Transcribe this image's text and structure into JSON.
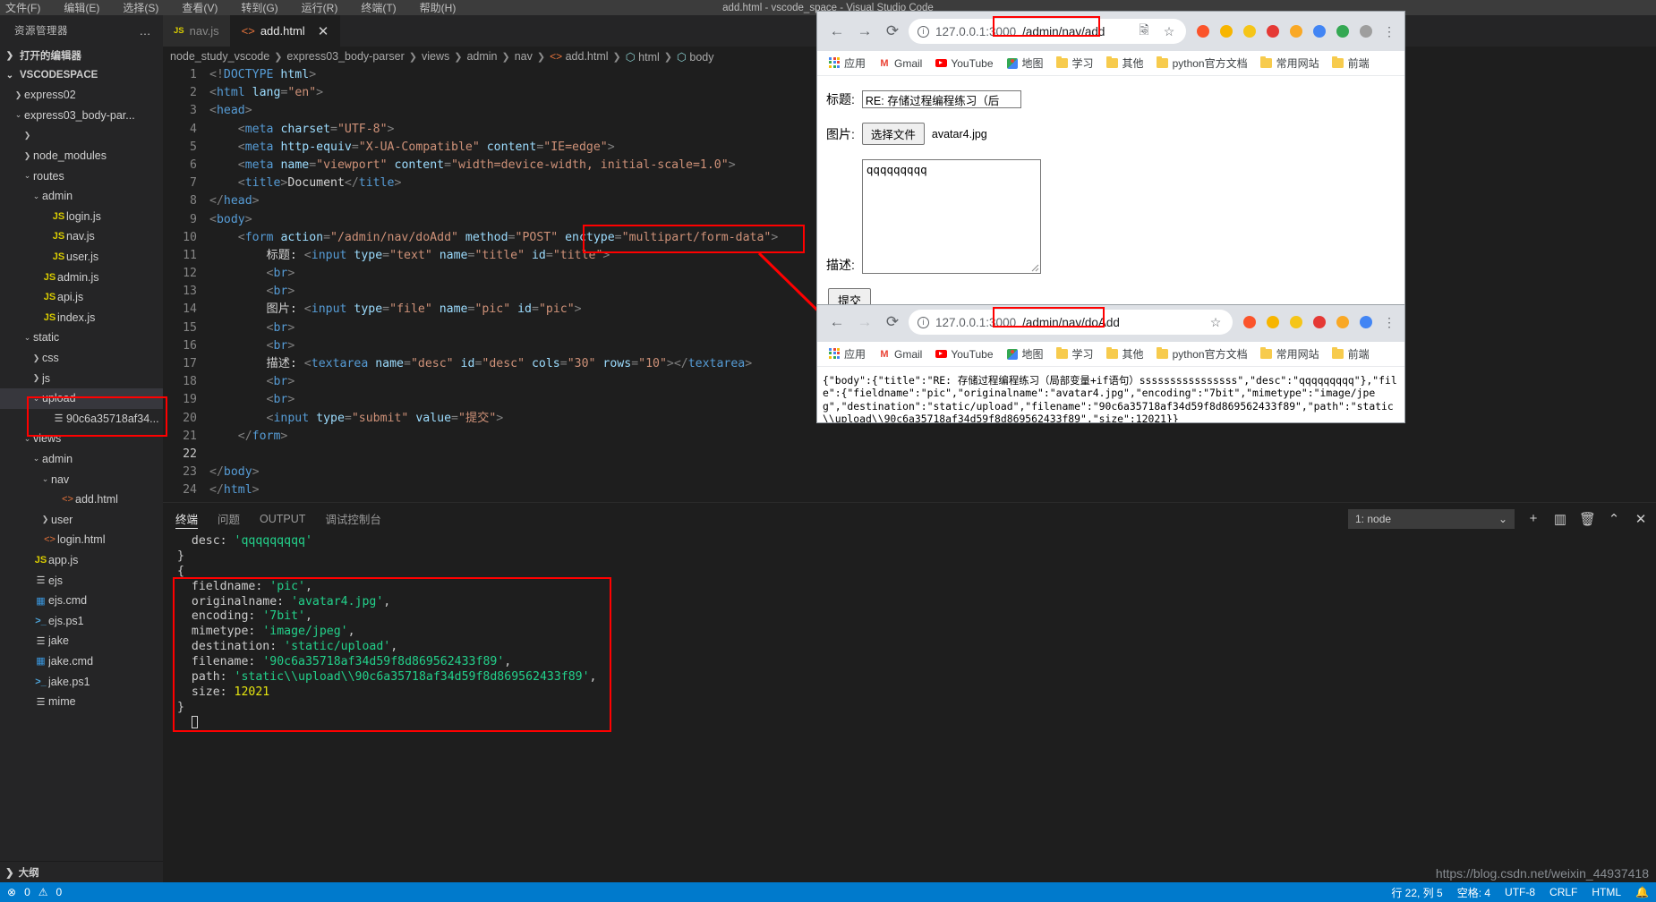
{
  "vscode": {
    "menu": [
      "文件(F)",
      "编辑(E)",
      "选择(S)",
      "查看(V)",
      "转到(G)",
      "运行(R)",
      "终端(T)",
      "帮助(H)"
    ],
    "window_title": "add.html - vscode_space - Visual Studio Code",
    "explorer": {
      "title": "资源管理器",
      "more_label": "…",
      "open_editors": "打开的编辑器",
      "workspace": "VSCODESPACE",
      "outline": "大纲",
      "tree": [
        {
          "label": "express02",
          "indent": 1,
          "chev": "collapsed",
          "icon": "none",
          "selected": false
        },
        {
          "label": "express03_body-par...",
          "indent": 1,
          "chev": "expanded",
          "icon": "none",
          "selected": false
        },
        {
          "label": "",
          "indent": 2,
          "chev": "collapsed",
          "icon": "none",
          "selected": false
        },
        {
          "label": "node_modules",
          "indent": 2,
          "chev": "collapsed",
          "icon": "none",
          "selected": false
        },
        {
          "label": "routes",
          "indent": 2,
          "chev": "expanded",
          "icon": "none",
          "selected": false
        },
        {
          "label": "admin",
          "indent": 3,
          "chev": "expanded",
          "icon": "none",
          "selected": false
        },
        {
          "label": "login.js",
          "indent": 4,
          "chev": "none",
          "icon": "js",
          "selected": false
        },
        {
          "label": "nav.js",
          "indent": 4,
          "chev": "none",
          "icon": "js",
          "selected": false
        },
        {
          "label": "user.js",
          "indent": 4,
          "chev": "none",
          "icon": "js",
          "selected": false
        },
        {
          "label": "admin.js",
          "indent": 3,
          "chev": "none",
          "icon": "js",
          "selected": false
        },
        {
          "label": "api.js",
          "indent": 3,
          "chev": "none",
          "icon": "js",
          "selected": false
        },
        {
          "label": "index.js",
          "indent": 3,
          "chev": "none",
          "icon": "js",
          "selected": false
        },
        {
          "label": "static",
          "indent": 2,
          "chev": "expanded",
          "icon": "none",
          "selected": false
        },
        {
          "label": "css",
          "indent": 3,
          "chev": "collapsed",
          "icon": "none",
          "selected": false
        },
        {
          "label": "js",
          "indent": 3,
          "chev": "collapsed",
          "icon": "none",
          "selected": false
        },
        {
          "label": "upload",
          "indent": 3,
          "chev": "expanded",
          "icon": "none",
          "selected": true
        },
        {
          "label": "90c6a35718af34...",
          "indent": 4,
          "chev": "none",
          "icon": "lines",
          "selected": false
        },
        {
          "label": "views",
          "indent": 2,
          "chev": "expanded",
          "icon": "none",
          "selected": false
        },
        {
          "label": "admin",
          "indent": 3,
          "chev": "expanded",
          "icon": "none",
          "selected": false
        },
        {
          "label": "nav",
          "indent": 4,
          "chev": "expanded",
          "icon": "none",
          "selected": false
        },
        {
          "label": "add.html",
          "indent": 5,
          "chev": "none",
          "icon": "html",
          "selected": false
        },
        {
          "label": "user",
          "indent": 4,
          "chev": "collapsed",
          "icon": "none",
          "selected": false
        },
        {
          "label": "login.html",
          "indent": 3,
          "chev": "none",
          "icon": "html",
          "selected": false
        },
        {
          "label": "app.js",
          "indent": 2,
          "chev": "none",
          "icon": "js",
          "selected": false
        },
        {
          "label": "ejs",
          "indent": 2,
          "chev": "none",
          "icon": "lines",
          "selected": false
        },
        {
          "label": "ejs.cmd",
          "indent": 2,
          "chev": "none",
          "icon": "win",
          "selected": false
        },
        {
          "label": "ejs.ps1",
          "indent": 2,
          "chev": "none",
          "icon": "ps",
          "selected": false
        },
        {
          "label": "jake",
          "indent": 2,
          "chev": "none",
          "icon": "lines",
          "selected": false
        },
        {
          "label": "jake.cmd",
          "indent": 2,
          "chev": "none",
          "icon": "win",
          "selected": false
        },
        {
          "label": "jake.ps1",
          "indent": 2,
          "chev": "none",
          "icon": "ps",
          "selected": false
        },
        {
          "label": "mime",
          "indent": 2,
          "chev": "none",
          "icon": "lines",
          "selected": false
        }
      ]
    },
    "tabs": [
      {
        "label": "nav.js",
        "icon": "js",
        "active": false,
        "closable": false
      },
      {
        "label": "add.html",
        "icon": "html",
        "active": true,
        "closable": true
      }
    ],
    "breadcrumb": [
      "node_study_vscode",
      "express03_body-parser",
      "views",
      "admin",
      "nav",
      "add.html",
      "html",
      "body"
    ],
    "code_lines": [
      {
        "n": 1,
        "html": "<span class='t-pnc'>&lt;!</span><span class='t-doc'>DOCTYPE</span> <span class='t-name'>html</span><span class='t-pnc'>&gt;</span>"
      },
      {
        "n": 2,
        "html": "<span class='t-pnc'>&lt;</span><span class='t-tag'>html</span> <span class='t-attr'>lang</span><span class='t-pnc'>=</span><span class='t-str'>\"en\"</span><span class='t-pnc'>&gt;</span>"
      },
      {
        "n": 3,
        "html": "<span class='t-pnc'>&lt;</span><span class='t-tag'>head</span><span class='t-pnc'>&gt;</span>"
      },
      {
        "n": 4,
        "html": "    <span class='t-pnc'>&lt;</span><span class='t-tag'>meta</span> <span class='t-attr'>charset</span><span class='t-pnc'>=</span><span class='t-str'>\"UTF-8\"</span><span class='t-pnc'>&gt;</span>"
      },
      {
        "n": 5,
        "html": "    <span class='t-pnc'>&lt;</span><span class='t-tag'>meta</span> <span class='t-attr'>http-equiv</span><span class='t-pnc'>=</span><span class='t-str'>\"X-UA-Compatible\"</span> <span class='t-attr'>content</span><span class='t-pnc'>=</span><span class='t-str'>\"IE=edge\"</span><span class='t-pnc'>&gt;</span>"
      },
      {
        "n": 6,
        "html": "    <span class='t-pnc'>&lt;</span><span class='t-tag'>meta</span> <span class='t-attr'>name</span><span class='t-pnc'>=</span><span class='t-str'>\"viewport\"</span> <span class='t-attr'>content</span><span class='t-pnc'>=</span><span class='t-str'>\"width=device-width, initial-scale=1.0\"</span><span class='t-pnc'>&gt;</span>"
      },
      {
        "n": 7,
        "html": "    <span class='t-pnc'>&lt;</span><span class='t-tag'>title</span><span class='t-pnc'>&gt;</span><span class='t-txt'>Document</span><span class='t-pnc'>&lt;/</span><span class='t-tag'>title</span><span class='t-pnc'>&gt;</span>"
      },
      {
        "n": 8,
        "html": "<span class='t-pnc'>&lt;/</span><span class='t-tag'>head</span><span class='t-pnc'>&gt;</span>"
      },
      {
        "n": 9,
        "html": "<span class='t-pnc'>&lt;</span><span class='t-tag'>body</span><span class='t-pnc'>&gt;</span>"
      },
      {
        "n": 10,
        "html": "    <span class='t-pnc'>&lt;</span><span class='t-tag'>form</span> <span class='t-attr'>action</span><span class='t-pnc'>=</span><span class='t-str'>\"/admin/nav/doAdd\"</span> <span class='t-attr'>method</span><span class='t-pnc'>=</span><span class='t-str'>\"POST\"</span> <span class='t-attr'>enctype</span><span class='t-pnc'>=</span><span class='t-str'>\"multipart/form-data\"</span><span class='t-pnc'>&gt;</span>"
      },
      {
        "n": 11,
        "html": "        <span class='t-txt'>标题: </span><span class='t-pnc'>&lt;</span><span class='t-tag'>input</span> <span class='t-attr'>type</span><span class='t-pnc'>=</span><span class='t-str'>\"text\"</span> <span class='t-attr'>name</span><span class='t-pnc'>=</span><span class='t-str'>\"title\"</span> <span class='t-attr'>id</span><span class='t-pnc'>=</span><span class='t-str'>\"title\"</span><span class='t-pnc'>&gt;</span>"
      },
      {
        "n": 12,
        "html": "        <span class='t-pnc'>&lt;</span><span class='t-tag'>br</span><span class='t-pnc'>&gt;</span>"
      },
      {
        "n": 13,
        "html": "        <span class='t-pnc'>&lt;</span><span class='t-tag'>br</span><span class='t-pnc'>&gt;</span>"
      },
      {
        "n": 14,
        "html": "        <span class='t-txt'>图片: </span><span class='t-pnc'>&lt;</span><span class='t-tag'>input</span> <span class='t-attr'>type</span><span class='t-pnc'>=</span><span class='t-str'>\"file\"</span> <span class='t-attr'>name</span><span class='t-pnc'>=</span><span class='t-str'>\"pic\"</span> <span class='t-attr'>id</span><span class='t-pnc'>=</span><span class='t-str'>\"pic\"</span><span class='t-pnc'>&gt;</span>"
      },
      {
        "n": 15,
        "html": "        <span class='t-pnc'>&lt;</span><span class='t-tag'>br</span><span class='t-pnc'>&gt;</span>"
      },
      {
        "n": 16,
        "html": "        <span class='t-pnc'>&lt;</span><span class='t-tag'>br</span><span class='t-pnc'>&gt;</span>"
      },
      {
        "n": 17,
        "html": "        <span class='t-txt'>描述: </span><span class='t-pnc'>&lt;</span><span class='t-tag'>textarea</span> <span class='t-attr'>name</span><span class='t-pnc'>=</span><span class='t-str'>\"desc\"</span> <span class='t-attr'>id</span><span class='t-pnc'>=</span><span class='t-str'>\"desc\"</span> <span class='t-attr'>cols</span><span class='t-pnc'>=</span><span class='t-str'>\"30\"</span> <span class='t-attr'>rows</span><span class='t-pnc'>=</span><span class='t-str'>\"10\"</span><span class='t-pnc'>&gt;&lt;/</span><span class='t-tag'>textarea</span><span class='t-pnc'>&gt;</span>"
      },
      {
        "n": 18,
        "html": "        <span class='t-pnc'>&lt;</span><span class='t-tag'>br</span><span class='t-pnc'>&gt;</span>"
      },
      {
        "n": 19,
        "html": "        <span class='t-pnc'>&lt;</span><span class='t-tag'>br</span><span class='t-pnc'>&gt;</span>"
      },
      {
        "n": 20,
        "html": "        <span class='t-pnc'>&lt;</span><span class='t-tag'>input</span> <span class='t-attr'>type</span><span class='t-pnc'>=</span><span class='t-str'>\"submit\"</span> <span class='t-attr'>value</span><span class='t-pnc'>=</span><span class='t-str'>\"提交\"</span><span class='t-pnc'>&gt;</span>"
      },
      {
        "n": 21,
        "html": "    <span class='t-pnc'>&lt;/</span><span class='t-tag'>form</span><span class='t-pnc'>&gt;</span>"
      },
      {
        "n": 22,
        "html": "    "
      },
      {
        "n": 23,
        "html": "<span class='t-pnc'>&lt;/</span><span class='t-tag'>body</span><span class='t-pnc'>&gt;</span>"
      },
      {
        "n": 24,
        "html": "<span class='t-pnc'>&lt;/</span><span class='t-tag'>html</span><span class='t-pnc'>&gt;</span>"
      }
    ],
    "panel": {
      "tabs": [
        "终端",
        "问题",
        "OUTPUT",
        "调试控制台"
      ],
      "active_tab": "终端",
      "terminal_selector": "1: node",
      "icons": {
        "add": "+",
        "split": "▥",
        "trash": "🗑",
        "chevron_up": "⌃",
        "close": "✕"
      },
      "terminal_lines": [
        {
          "html": "  <span class='s-key'>desc:</span> <span class='s-str'>'qqqqqqqqq'</span>"
        },
        {
          "html": "<span class='s-key'>}</span>"
        },
        {
          "html": "<span class='s-key'>{</span>"
        },
        {
          "html": "  <span class='s-key'>fieldname:</span> <span class='s-str'>'pic'</span><span class='s-key'>,</span>"
        },
        {
          "html": "  <span class='s-key'>originalname:</span> <span class='s-str'>'avatar4.jpg'</span><span class='s-key'>,</span>"
        },
        {
          "html": "  <span class='s-key'>encoding:</span> <span class='s-str'>'7bit'</span><span class='s-key'>,</span>"
        },
        {
          "html": "  <span class='s-key'>mimetype:</span> <span class='s-str'>'image/jpeg'</span><span class='s-key'>,</span>"
        },
        {
          "html": "  <span class='s-key'>destination:</span> <span class='s-str'>'static/upload'</span><span class='s-key'>,</span>"
        },
        {
          "html": "  <span class='s-key'>filename:</span> <span class='s-str'>'90c6a35718af34d59f8d869562433f89'</span><span class='s-key'>,</span>"
        },
        {
          "html": "  <span class='s-key'>path:</span> <span class='s-str'>'static\\\\upload\\\\90c6a35718af34d59f8d869562433f89'</span><span class='s-key'>,</span>"
        },
        {
          "html": "  <span class='s-key'>size:</span> <span class='s-num'>12021</span>"
        },
        {
          "html": "<span class='s-key'>}</span>"
        },
        {
          "html": "  <span class='cursorblk'></span>"
        }
      ]
    },
    "statusbar": {
      "errors_icon": "⊗",
      "errors": "0",
      "warnings_icon": "⚠",
      "warnings": "0",
      "line_col": "行 22, 列 5",
      "spaces": "空格: 4",
      "encoding": "UTF-8",
      "eol": "CRLF",
      "language": "HTML",
      "bell": "🔔"
    }
  },
  "browser1": {
    "nav": {
      "back": "←",
      "forward": "→",
      "reload": "⟳"
    },
    "url_prefix": "127.0.0.1:3000",
    "url_suffix": "/admin/nav/add",
    "toolbar_icons": [
      "translate-icon",
      "star-icon",
      "brave-icon",
      "ext-orange-icon",
      "ext-y-icon",
      "ext-pink-icon",
      "ext-face-icon",
      "ext-blue-icon",
      "ext-green-icon",
      "ext-grey-icon",
      "profile-icon",
      "menu-icon"
    ],
    "bookmarks": [
      {
        "label": "应用",
        "icon": "grid"
      },
      {
        "label": "Gmail",
        "icon": "gmail"
      },
      {
        "label": "YouTube",
        "icon": "youtube"
      },
      {
        "label": "地图",
        "icon": "maps"
      },
      {
        "label": "学习",
        "icon": "folder"
      },
      {
        "label": "其他",
        "icon": "folder"
      },
      {
        "label": "python官方文档",
        "icon": "folder"
      },
      {
        "label": "常用网站",
        "icon": "folder"
      },
      {
        "label": "前端",
        "icon": "folder"
      }
    ],
    "form": {
      "title_label": "标题:",
      "title_value": "RE: 存储过程编程练习（后",
      "pic_label": "图片:",
      "choose_file_button": "选择文件",
      "chosen_file": "avatar4.jpg",
      "desc_label": "描述:",
      "desc_value": "qqqqqqqqq",
      "submit_label": "提交"
    }
  },
  "browser2": {
    "nav": {
      "back": "←",
      "forward": "→",
      "reload": "⟳"
    },
    "url_prefix": "127.0.0.1:3000",
    "url_suffix": "/admin/nav/doAdd",
    "bookmarks": [
      {
        "label": "应用",
        "icon": "grid"
      },
      {
        "label": "Gmail",
        "icon": "gmail"
      },
      {
        "label": "YouTube",
        "icon": "youtube"
      },
      {
        "label": "地图",
        "icon": "maps"
      },
      {
        "label": "学习",
        "icon": "folder"
      },
      {
        "label": "其他",
        "icon": "folder"
      },
      {
        "label": "python官方文档",
        "icon": "folder"
      },
      {
        "label": "常用网站",
        "icon": "folder"
      },
      {
        "label": "前端",
        "icon": "folder"
      }
    ],
    "response_json": "{\"body\":{\"title\":\"RE: 存储过程编程练习（局部变量+if语句）ssssssssssssssss\",\"desc\":\"qqqqqqqqq\"},\"file\":{\"fieldname\":\"pic\",\"originalname\":\"avatar4.jpg\",\"encoding\":\"7bit\",\"mimetype\":\"image/jpeg\",\"destination\":\"static/upload\",\"filename\":\"90c6a35718af34d59f8d869562433f89\",\"path\":\"static\\\\upload\\\\90c6a35718af34d59f8d869562433f89\",\"size\":12021}}"
  },
  "watermark": "https://blog.csdn.net/weixin_44937418",
  "colors": {
    "accent": "#007acc",
    "annotation": "#ff0000",
    "sidebar_bg": "#252526",
    "editor_bg": "#1e1e1e"
  }
}
